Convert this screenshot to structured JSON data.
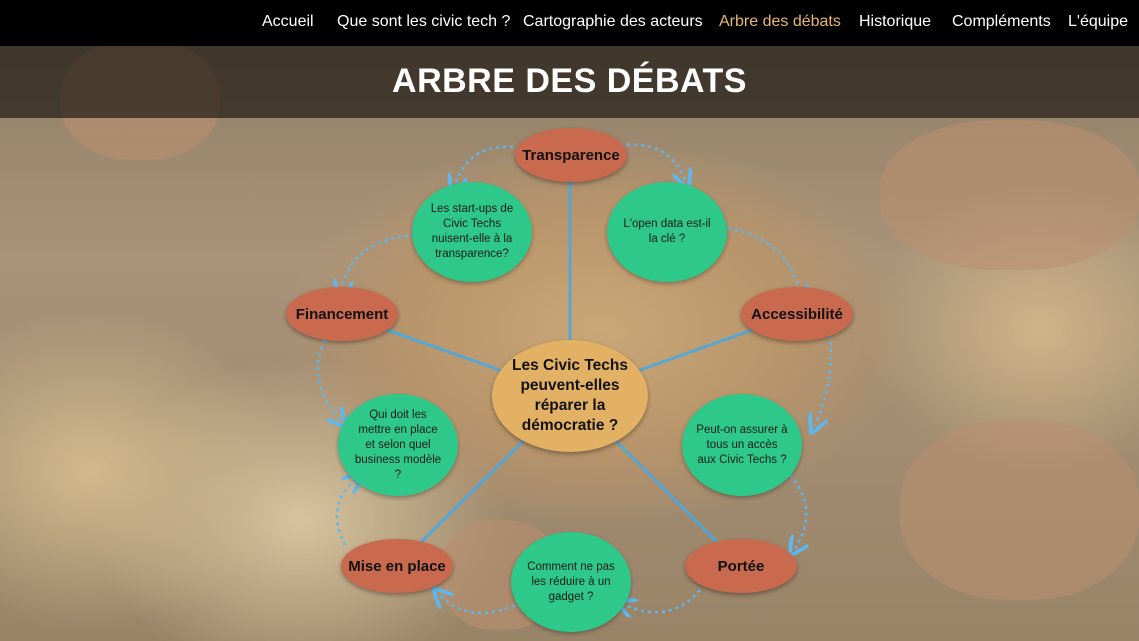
{
  "nav": {
    "items": [
      {
        "label": "Accueil"
      },
      {
        "label": "Que sont les civic tech ?"
      },
      {
        "label": "Cartographie des acteurs"
      },
      {
        "label": "Arbre des débats"
      },
      {
        "label": "Historique"
      },
      {
        "label": "Compléments"
      },
      {
        "label": "L'équipe"
      }
    ],
    "active_color": "#e8b86a"
  },
  "page": {
    "title": "ARBRE DES DÉBATS"
  },
  "tree": {
    "center": "Les Civic Techs peuvent-elles réparer la démocratie ?",
    "themes": {
      "transparence": "Transparence",
      "accessibilite": "Accessibilité",
      "portee": "Portée",
      "mise_en_place": "Mise en place",
      "financement": "Financement"
    },
    "questions": {
      "startups": "Les start-ups de Civic Techs nuisent-elle à la transparence?",
      "open_data": "L'open data est-il la clé ?",
      "acces": "Peut-on assurer à tous un accès aux Civic Techs ?",
      "gadget": "Comment ne pas les réduire à un gadget ?",
      "business": "Qui doit les mettre en place et selon quel business modèle ?"
    },
    "colors": {
      "theme": "#c96a4f",
      "question": "#2ec98a",
      "center": "#e3b163",
      "spoke": "#4aa8e0",
      "ring": "#5cb8ee"
    }
  }
}
